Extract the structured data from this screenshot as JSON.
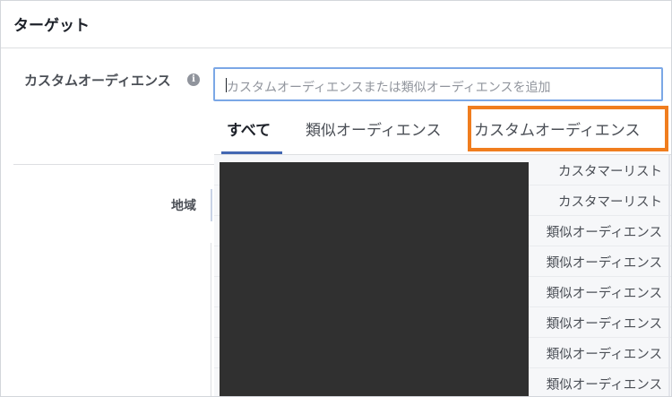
{
  "header": {
    "title": "ターゲット"
  },
  "custom_audience": {
    "label": "カスタムオーディエンス",
    "info_icon": "info-icon",
    "input_placeholder": "カスタムオーディエンスまたは類似オーディエンスを追加"
  },
  "region": {
    "label": "地域"
  },
  "dropdown": {
    "tabs": [
      {
        "label": "すべて",
        "active": true
      },
      {
        "label": "類似オーディエンス",
        "active": false
      },
      {
        "label": "カスタムオーディエンス",
        "active": false,
        "highlighted": true
      }
    ],
    "rows": [
      {
        "type": "カスタマーリスト"
      },
      {
        "type": "カスタマーリスト"
      },
      {
        "type": "類似オーディエンス"
      },
      {
        "type": "類似オーディエンス"
      },
      {
        "type": "類似オーディエンス"
      },
      {
        "type": "類似オーディエンス"
      },
      {
        "type": "類似オーディエンス"
      },
      {
        "type": "類似オーディエンス"
      }
    ]
  },
  "colors": {
    "active_tab_underline": "#4267b2",
    "highlight_border": "#f07d1e",
    "input_focus_border": "#7ba7e6",
    "redaction": "#303030"
  }
}
